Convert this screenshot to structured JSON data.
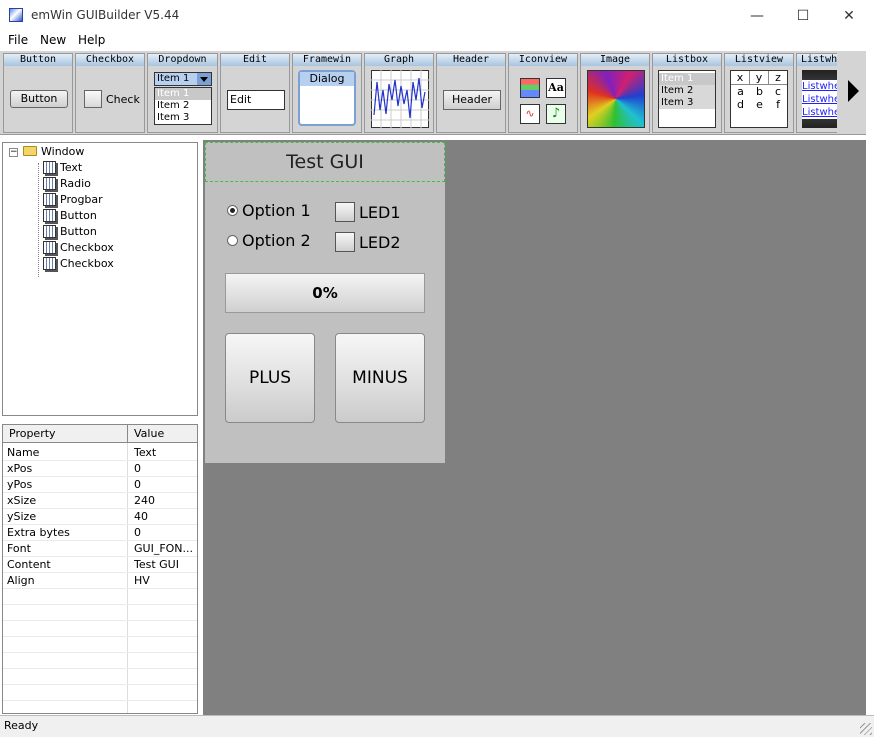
{
  "window": {
    "title": "emWin GUIBuilder V5.44"
  },
  "menu": [
    "File",
    "New",
    "Help"
  ],
  "toolbar": {
    "tools": [
      "Button",
      "Checkbox",
      "Dropdown",
      "Edit",
      "Framewin",
      "Graph",
      "Header",
      "Iconview",
      "Image",
      "Listbox",
      "Listview",
      "Listwh"
    ],
    "button_label": "Button",
    "checkbox_label": "Check",
    "dropdown_selected": "Item 1",
    "dropdown_items": [
      "Item 1",
      "Item 2",
      "Item 3"
    ],
    "edit_value": "Edit",
    "framewin_caption": "Dialog",
    "header_label": "Header",
    "iconview_text_icon": "Aa",
    "listbox_items": [
      "Item 1",
      "Item 2",
      "Item 3"
    ],
    "listview_header": [
      "x",
      "y",
      "z"
    ],
    "listview_rows": [
      [
        "a",
        "b",
        "c"
      ],
      [
        "d",
        "e",
        "f"
      ]
    ],
    "listwheel_items": [
      "Listwhe",
      "Listwhe",
      "Listwhe"
    ]
  },
  "tree": {
    "root": "Window",
    "children": [
      "Text",
      "Radio",
      "Progbar",
      "Button",
      "Button",
      "Checkbox",
      "Checkbox"
    ]
  },
  "properties": {
    "header": {
      "property": "Property",
      "value": "Value"
    },
    "rows": [
      {
        "name": "Name",
        "value": "Text"
      },
      {
        "name": "xPos",
        "value": "0"
      },
      {
        "name": "yPos",
        "value": "0"
      },
      {
        "name": "xSize",
        "value": "240"
      },
      {
        "name": "ySize",
        "value": "40"
      },
      {
        "name": "Extra bytes",
        "value": "0"
      },
      {
        "name": "Font",
        "value": "GUI_FON..."
      },
      {
        "name": "Content",
        "value": "Test GUI"
      },
      {
        "name": "Align",
        "value": "HV"
      }
    ]
  },
  "canvas": {
    "title": "Test GUI",
    "radio": [
      {
        "label": "Option 1",
        "selected": true
      },
      {
        "label": "Option 2",
        "selected": false
      }
    ],
    "leds": [
      "LED1",
      "LED2"
    ],
    "progress_text": "0%",
    "progress_value": 0,
    "buttons": [
      "PLUS",
      "MINUS"
    ]
  },
  "status": {
    "text": "Ready"
  },
  "colors": {
    "canvas_bg": "#808080",
    "dialog_bg": "#c0c0c0",
    "selection_outline": "#3cc23c",
    "tool_header": "#a8c4e0"
  }
}
